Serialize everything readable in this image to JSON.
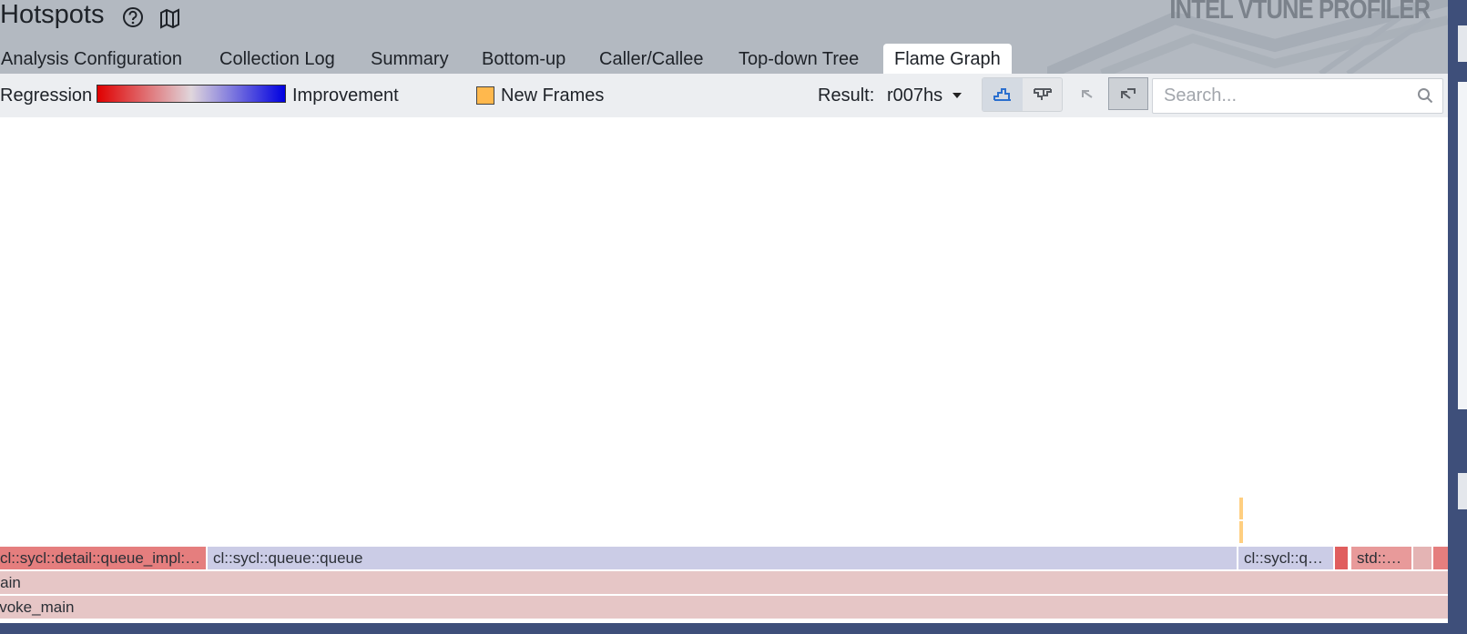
{
  "header": {
    "title": "Hotspots",
    "brand": "INTEL VTUNE PROFILER",
    "help_icon": "question-circle-icon",
    "map_icon": "map-help-icon"
  },
  "tabs": [
    {
      "label": "Analysis Configuration",
      "active": false
    },
    {
      "label": "Collection Log",
      "active": false
    },
    {
      "label": "Summary",
      "active": false
    },
    {
      "label": "Bottom-up",
      "active": false
    },
    {
      "label": "Caller/Callee",
      "active": false
    },
    {
      "label": "Top-down Tree",
      "active": false
    },
    {
      "label": "Flame Graph",
      "active": true
    }
  ],
  "toolbar": {
    "regression_label": "Regression",
    "improvement_label": "Improvement",
    "new_frames_label": "New Frames",
    "result_label": "Result:",
    "result_value": "r007hs",
    "search_placeholder": "Search...",
    "buttons": [
      "flame-graph-icon",
      "icicle-graph-icon",
      "undo-zoom-icon",
      "reset-zoom-icon"
    ]
  },
  "colors": {
    "regression": "#e00000",
    "improvement": "#0000e0",
    "new_frames": "#ffb84d",
    "frame_regression": "#e57e7e",
    "frame_neutral": "#cbcce6",
    "frame_base": "#e6c6c6"
  },
  "flame": {
    "row0": {
      "f1": "cl::sycl::detail::queue_impl:…",
      "f2": "cl::sycl::queue::queue",
      "f3": "cl::sycl::q…",
      "f4": "std::…"
    },
    "row1": "main",
    "row2": "invoke_main"
  }
}
